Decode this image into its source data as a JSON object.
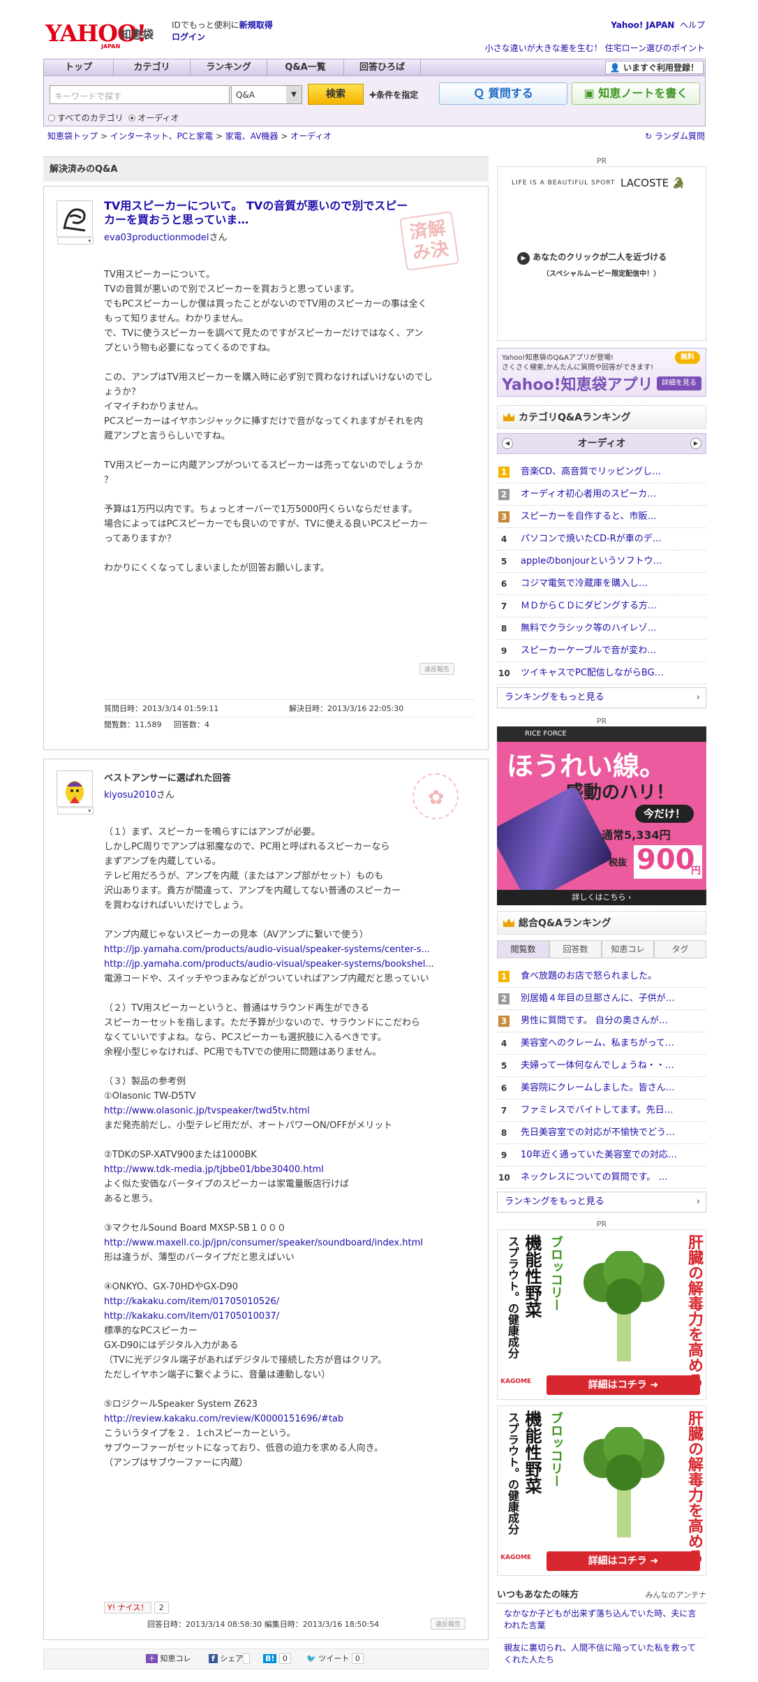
{
  "header": {
    "logo_text": "YAHOO!",
    "logo_sub": "JAPAN",
    "service": "知恵袋",
    "tagline_pre": "IDでもっと便利に",
    "tagline_link": "新規取得",
    "login": "ログイン",
    "yahoo_japan": "Yahoo! JAPAN",
    "help": "ヘルプ",
    "promo": "小さな違いが大きな差を生む！ 住宅ローン選びのポイント"
  },
  "nav": {
    "items": [
      "トップ",
      "カテゴリ",
      "ランキング",
      "Q&A一覧",
      "回答ひろば"
    ],
    "register": "いますぐ利用登録！"
  },
  "search": {
    "placeholder": "キーワードで探す",
    "select_value": "Q&A",
    "button": "検索",
    "condition": "条件を指定",
    "ask": "質問する",
    "note": "知恵ノートを書く",
    "radio_all": "すべてのカテゴリ",
    "radio_audio": "オーディオ"
  },
  "breadcrumb": [
    "知恵袋トップ",
    "インターネット、PCと家電",
    "家電、AV機器",
    "オーディオ"
  ],
  "random": "ランダム質問",
  "main": {
    "section_title": "解決済みのQ&A"
  },
  "question": {
    "title": "TV用スピーカーについて。 TVの音質が悪いので別でスピーカーを買おうと思っていま…",
    "user": "eva03productionmodel",
    "san": "さん",
    "stamp": "済解 み決",
    "body": [
      "TV用スピーカーについて。",
      "TVの音質が悪いので別でスピーカーを買おうと思っています。",
      "でもPCスピーカーしか僕は買ったことがないのでTV用のスピーカーの事は全く",
      "もって知りません。わかりません。",
      "で、TVに使うスピーカーを調べて見たのですがスピーカーだけではなく、アン",
      "プという物も必要になってくるのですね。",
      "",
      "この、アンプはTV用スピーカーを購入時に必ず別で買わなければいけないのでし",
      "ょうか？",
      "イマイチわかりません。",
      "PCスピーカーはイヤホンジャックに挿すだけで音がなってくれますがそれを内",
      "蔵アンプと言うらしいですね。",
      "",
      "TV用スピーカーに内蔵アンプがついてるスピーカーは売ってないのでしょうか",
      "？",
      "",
      "予算は1万円以内です。ちょっとオーバーで1万5000円くらいならだせます。",
      "場合によってはPCスピーカーでも良いのですが、TVに使える良いPCスピーカー",
      "ってありますか？",
      "",
      "わかりにくくなってしまいましたが回答お願いします。"
    ],
    "report": "違反報告",
    "asked": "質問日時：2013/3/14 01:59:11",
    "resolved": "解決日時：2013/3/16 22:05:30",
    "views": "閲覧数：11,589",
    "answers": "回答数：4"
  },
  "answer": {
    "label": "ベストアンサーに選ばれた回答",
    "user": "kiyosu2010",
    "san": "さん",
    "body": [
      {
        "t": "（１）まず、スピーカーを鳴らすにはアンプが必要。"
      },
      {
        "t": "しかしPC周りでアンプは邪魔なので、PC用と呼ばれるスピーカーなら"
      },
      {
        "t": "まずアンプを内蔵している。"
      },
      {
        "t": "テレビ用だろうが、アンプを内蔵（またはアンプ部がセット）ものも"
      },
      {
        "t": "沢山あります。貴方が間違って、アンプを内蔵してない普通のスピーカー"
      },
      {
        "t": "を買わなければいいだけでしょう。"
      },
      {
        "t": ""
      },
      {
        "t": "アンプ内蔵じゃないスピーカーの見本（AVアンプに繋いで使う）"
      },
      {
        "u": "http://jp.yamaha.com/products/audio-visual/speaker-systems/center-s..."
      },
      {
        "u": "http://jp.yamaha.com/products/audio-visual/speaker-systems/bookshel..."
      },
      {
        "t": "電源コードや、スイッチやつまみなどがついていればアンプ内蔵だと思っていい"
      },
      {
        "t": ""
      },
      {
        "t": "（２）TV用スピーカーというと、普通はサラウンド再生ができる"
      },
      {
        "t": "スピーカーセットを指します。ただ予算が少ないので、サラウンドにこだわら"
      },
      {
        "t": "なくていいですよね。なら、PCスピーカーも選択肢に入るべきです。"
      },
      {
        "t": "余程小型じゃなければ、PC用でもTVでの使用に問題はありません。"
      },
      {
        "t": ""
      },
      {
        "t": "（３）製品の参考例"
      },
      {
        "t": "①Olasonic TW-D5TV"
      },
      {
        "u": "http://www.olasonic.jp/tvspeaker/twd5tv.html"
      },
      {
        "t": "まだ発売前だし、小型テレビ用だが、オートパワーON/OFFがメリット"
      },
      {
        "t": ""
      },
      {
        "t": "②TDKのSP-XATV900または1000BK"
      },
      {
        "u": "http://www.tdk-media.jp/tjbbe01/bbe30400.html"
      },
      {
        "t": "よく似た安価なバータイプのスピーカーは家電量販店行けば"
      },
      {
        "t": "あると思う。"
      },
      {
        "t": ""
      },
      {
        "t": "③マクセルSound Board MXSP-SB１０００"
      },
      {
        "u": "http://www.maxell.co.jp/jpn/consumer/speaker/soundboard/index.html"
      },
      {
        "t": "形は違うが、薄型のバータイプだと思えばいい"
      },
      {
        "t": ""
      },
      {
        "t": "④ONKYO、GX-70HDやGX-D90"
      },
      {
        "u": "http://kakaku.com/item/01705010526/"
      },
      {
        "u": "http://kakaku.com/item/01705010037/"
      },
      {
        "t": "標準的なPCスピーカー"
      },
      {
        "t": "GX-D90にはデジタル入力がある"
      },
      {
        "t": "（TVに光デジタル端子があればデジタルで接続した方が音はクリア。"
      },
      {
        "t": "ただしイヤホン端子に繋ぐように、音量は連動しない）"
      },
      {
        "t": ""
      },
      {
        "t": "⑤ロジクールSpeaker System Z623"
      },
      {
        "u": "http://review.kakaku.com/review/K0000151696/#tab"
      },
      {
        "t": "こういうタイプを２．１chスピーカーという。"
      },
      {
        "t": "サブウーファーがセットになっており、低音の迫力を求める人向き。"
      },
      {
        "t": "（アンプはサブウーファーに内蔵）"
      }
    ],
    "like": "Y! ナイス！",
    "like_count": "2",
    "meta": "回答日時：2013/3/14 08:58:30 編集日時：2013/3/16 18:50:54",
    "report": "違反報告"
  },
  "share": {
    "chie": "知恵コレ",
    "fb": "シェア",
    "fb_count": "",
    "b_count": "0",
    "tweet": "ツイート",
    "tweet_count": "0"
  },
  "sidebar": {
    "pr": "PR",
    "ad1": {
      "tag": "LIFE IS A BEAUTIFUL SPORT",
      "brand": "LACOSTE",
      "cta": "あなたのクリックが二人を近づける",
      "sub": "（スペシャルムービー限定配信中！）"
    },
    "app": {
      "l1": "Yahoo!知恵袋のQ&Aアプリが登場!",
      "l2": "さくさく検索,かんたんに質問や回答ができます!",
      "name": "Yahoo!知恵袋アプリ",
      "free": "無料",
      "btn": "詳細を見る"
    },
    "cat_rank": {
      "title": "カテゴリQ&Aランキング",
      "category": "オーディオ",
      "items": [
        "音楽CD、高音質でリッピングし…",
        "オーディオ初心者用のスピーカ…",
        "スピーカーを自作すると、市販…",
        "パソコンで焼いたCD-Rが車のデ…",
        "appleのbonjourというソフトウ…",
        "コジマ電気で冷蔵庫を購入し…",
        "ＭＤからＣＤにダビングする方…",
        "無料でクラシック等のハイレゾ…",
        "スピーカーケーブルで音が変わ…",
        "ツイキャスでPC配信しながらBG…"
      ],
      "more": "ランキングをもっと見る"
    },
    "ad2": {
      "brand": "RICE FORCE",
      "l1": "ほうれい線。",
      "l2": "感動のハリ！",
      "today": "今だけ！",
      "normal": "通常5,334円",
      "tax": "税抜",
      "price": "900",
      "yen": "円",
      "detail": "詳しくはこちら"
    },
    "total_rank": {
      "title": "総合Q&Aランキング",
      "tabs": [
        "閲覧数",
        "回答数",
        "知恵コレ",
        "タグ"
      ],
      "items": [
        "食べ放題のお店で怒られました。",
        "別居婚４年目の旦那さんに、子供が…",
        "男性に質問です。 自分の奥さんが…",
        "美容室へのクレーム、私まちがって…",
        "夫婦って一体何なんでしょうね・・…",
        "美容院にクレームしました。皆さん…",
        "ファミレスでバイトしてます。先日…",
        "先日美容室での対応が不愉快でどう…",
        "10年近く通っていた美容室での対応…",
        "ネックレスについての質問です。 …"
      ],
      "more": "ランキングをもっと見る"
    },
    "ad3": {
      "l1": "機能性野菜",
      "l2": "ブロッコリー",
      "l3": "スプラウト。の健康成分",
      "r1": "肝臓の解毒力を高める",
      "brand": "KAGOME",
      "btn": "詳細はコチラ"
    },
    "mikata": {
      "title": "いつもあなたの味方",
      "sub": "みんなのアンテナ",
      "items": [
        "なかなか子どもが出来ず落ち込んでいた時、夫に言われた言葉",
        "親友に裏切られ、人間不信に陥っていた私を救ってくれた人たち"
      ]
    }
  },
  "colors": {
    "accent": "#1a0dab",
    "nav_bg": "#e4dbf0",
    "ad_pink": "#e8478e"
  }
}
